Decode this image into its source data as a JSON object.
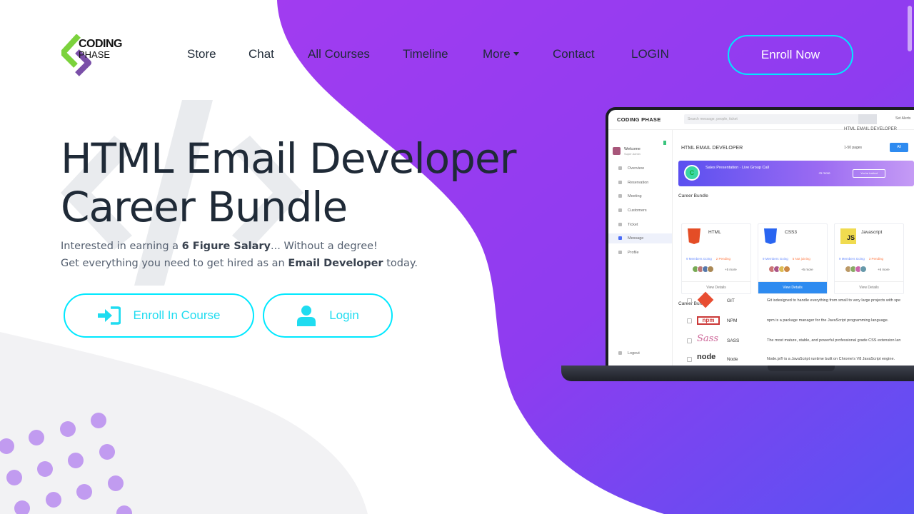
{
  "brand": {
    "logo_line1": "CODING",
    "logo_line2": "PHASE"
  },
  "nav": {
    "items": [
      "Store",
      "Chat",
      "All Courses",
      "Timeline",
      "More",
      "Contact",
      "LOGIN"
    ],
    "cta": "Enroll Now"
  },
  "hero": {
    "title_line1": "HTML Email Developer",
    "title_line2": "Career Bundle",
    "sub1_pre": "Interested in earning a ",
    "sub1_bold": "6 Figure Salary",
    "sub1_post": "... Without a degree!",
    "sub2_pre": "Get everything you need to get hired as an ",
    "sub2_bold": "Email Developer",
    "sub2_post": " today.",
    "buttons": {
      "enroll": "Enroll In Course",
      "login": "Login"
    }
  },
  "mockup": {
    "brand": "CODING PHASE",
    "search_placeholder": "Search message, people, ticket",
    "alerts": "Set Alerts",
    "profile_name": "Welcome",
    "profile_role": "Super Admin",
    "sidebar": [
      "Overview",
      "Reservation",
      "Meeting",
      "Customers",
      "Ticket",
      "Message",
      "Profile"
    ],
    "logout": "Logout",
    "header_right": "HTML EMAIL DEVELOPER",
    "page_title": "HTML EMAIL DEVELOPER",
    "pager": "1-50 pages",
    "all_button": "All",
    "banner_initial": "C",
    "banner_title": "Sales Presentation",
    "banner_sub": "Live Group Call",
    "banner_more": "+5 more",
    "banner_button": "You're invited",
    "section1": "Career Bundle",
    "section2": "Career Bundle",
    "cards": [
      {
        "title": "HTML",
        "members": "9 Members Going",
        "status": "2 Pending",
        "more": "+5 more",
        "action": "View Details"
      },
      {
        "title": "CSS3",
        "members": "9 Members Going",
        "status": "5 Not joining",
        "more": "+5 more",
        "action": "View Details"
      },
      {
        "title": "Javascript",
        "members": "9 Members Going",
        "status": "3 Pending",
        "more": "+6 more",
        "action": "View Details"
      }
    ],
    "rows": [
      {
        "name": "GIT",
        "desc": "Git isdesigned to handle everything from small to very large projects with spe"
      },
      {
        "name": "NPM",
        "desc": "npm is a package manager for the JavaScript programming language."
      },
      {
        "name": "SASS",
        "desc": "The most mature, stable, and powerful professional grade CSS extension lan"
      },
      {
        "name": "Node",
        "desc": "Node.js® is a JavaScript runtime built on Chrome's V8 JavaScript engine."
      }
    ]
  },
  "colors": {
    "accent": "#00e8ff",
    "purple_start": "#a13cf0",
    "purple_end": "#6a4cf0",
    "text": "#1f2a37"
  }
}
